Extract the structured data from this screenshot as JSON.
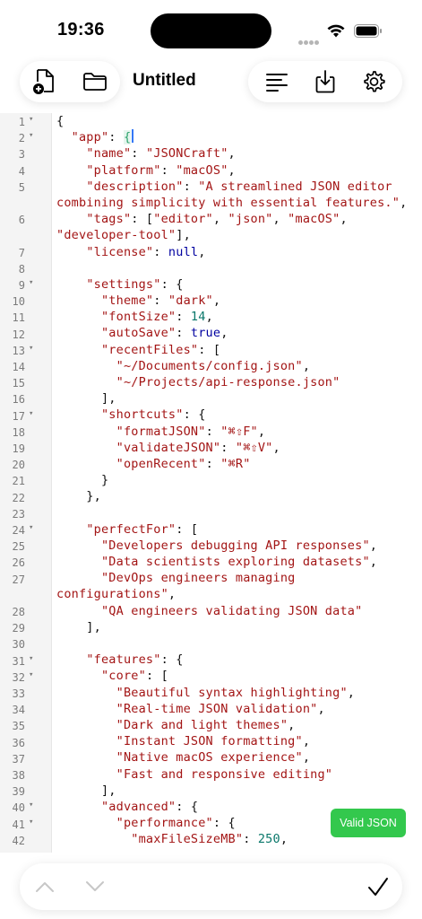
{
  "status_bar": {
    "time": "19:36"
  },
  "toolbar": {
    "title": "Untitled",
    "icons": {
      "new_file": "new-file-icon",
      "open_folder": "folder-icon",
      "format": "format-lines-icon",
      "save": "download-icon",
      "settings": "gear-icon"
    }
  },
  "editor": {
    "fold_marker": "▾",
    "lines": [
      {
        "n": "1",
        "fold": true
      },
      {
        "n": "2",
        "fold": true
      },
      {
        "n": "3",
        "fold": false
      },
      {
        "n": "4",
        "fold": false
      },
      {
        "n": "5",
        "fold": false
      },
      {
        "n": "",
        "fold": false
      },
      {
        "n": "6",
        "fold": false
      },
      {
        "n": "",
        "fold": false
      },
      {
        "n": "7",
        "fold": false
      },
      {
        "n": "8",
        "fold": false
      },
      {
        "n": "9",
        "fold": true
      },
      {
        "n": "10",
        "fold": false
      },
      {
        "n": "11",
        "fold": false
      },
      {
        "n": "12",
        "fold": false
      },
      {
        "n": "13",
        "fold": true
      },
      {
        "n": "14",
        "fold": false
      },
      {
        "n": "15",
        "fold": false
      },
      {
        "n": "16",
        "fold": false
      },
      {
        "n": "17",
        "fold": true
      },
      {
        "n": "18",
        "fold": false
      },
      {
        "n": "19",
        "fold": false
      },
      {
        "n": "20",
        "fold": false
      },
      {
        "n": "21",
        "fold": false
      },
      {
        "n": "22",
        "fold": false
      },
      {
        "n": "23",
        "fold": false
      },
      {
        "n": "24",
        "fold": true
      },
      {
        "n": "25",
        "fold": false
      },
      {
        "n": "26",
        "fold": false
      },
      {
        "n": "27",
        "fold": false
      },
      {
        "n": "",
        "fold": false
      },
      {
        "n": "28",
        "fold": false
      },
      {
        "n": "29",
        "fold": false
      },
      {
        "n": "30",
        "fold": false
      },
      {
        "n": "31",
        "fold": true
      },
      {
        "n": "32",
        "fold": true
      },
      {
        "n": "33",
        "fold": false
      },
      {
        "n": "34",
        "fold": false
      },
      {
        "n": "35",
        "fold": false
      },
      {
        "n": "36",
        "fold": false
      },
      {
        "n": "37",
        "fold": false
      },
      {
        "n": "38",
        "fold": false
      },
      {
        "n": "39",
        "fold": false
      },
      {
        "n": "40",
        "fold": true
      },
      {
        "n": "41",
        "fold": true
      },
      {
        "n": "42",
        "fold": false
      }
    ],
    "code": [
      [
        [
          "p",
          "{"
        ]
      ],
      [
        [
          "p",
          "  "
        ],
        [
          "k",
          "\"app\""
        ],
        [
          "p",
          ": "
        ],
        [
          "h",
          "{"
        ],
        [
          "c",
          ""
        ]
      ],
      [
        [
          "p",
          "    "
        ],
        [
          "k",
          "\"name\""
        ],
        [
          "p",
          ": "
        ],
        [
          "s",
          "\"JSONCraft\""
        ],
        [
          "p",
          ","
        ]
      ],
      [
        [
          "p",
          "    "
        ],
        [
          "k",
          "\"platform\""
        ],
        [
          "p",
          ": "
        ],
        [
          "s",
          "\"macOS\""
        ],
        [
          "p",
          ","
        ]
      ],
      [
        [
          "p",
          "    "
        ],
        [
          "k",
          "\"description\""
        ],
        [
          "p",
          ": "
        ],
        [
          "s",
          "\"A streamlined JSON editor"
        ]
      ],
      [
        [
          "s",
          "combining simplicity with essential features.\""
        ],
        [
          "p",
          ","
        ]
      ],
      [
        [
          "p",
          "    "
        ],
        [
          "k",
          "\"tags\""
        ],
        [
          "p",
          ": ["
        ],
        [
          "s",
          "\"editor\""
        ],
        [
          "p",
          ", "
        ],
        [
          "s",
          "\"json\""
        ],
        [
          "p",
          ", "
        ],
        [
          "s",
          "\"macOS\""
        ],
        [
          "p",
          ","
        ]
      ],
      [
        [
          "s",
          "\"developer-tool\""
        ],
        [
          "p",
          "],"
        ]
      ],
      [
        [
          "p",
          "    "
        ],
        [
          "k",
          "\"license\""
        ],
        [
          "p",
          ": "
        ],
        [
          "b",
          "null"
        ],
        [
          "p",
          ","
        ]
      ],
      [
        [
          "p",
          ""
        ]
      ],
      [
        [
          "p",
          "    "
        ],
        [
          "k",
          "\"settings\""
        ],
        [
          "p",
          ": {"
        ]
      ],
      [
        [
          "p",
          "      "
        ],
        [
          "k",
          "\"theme\""
        ],
        [
          "p",
          ": "
        ],
        [
          "s",
          "\"dark\""
        ],
        [
          "p",
          ","
        ]
      ],
      [
        [
          "p",
          "      "
        ],
        [
          "k",
          "\"fontSize\""
        ],
        [
          "p",
          ": "
        ],
        [
          "n",
          "14"
        ],
        [
          "p",
          ","
        ]
      ],
      [
        [
          "p",
          "      "
        ],
        [
          "k",
          "\"autoSave\""
        ],
        [
          "p",
          ": "
        ],
        [
          "b",
          "true"
        ],
        [
          "p",
          ","
        ]
      ],
      [
        [
          "p",
          "      "
        ],
        [
          "k",
          "\"recentFiles\""
        ],
        [
          "p",
          ": ["
        ]
      ],
      [
        [
          "p",
          "        "
        ],
        [
          "s",
          "\"~/Documents/config.json\""
        ],
        [
          "p",
          ","
        ]
      ],
      [
        [
          "p",
          "        "
        ],
        [
          "s",
          "\"~/Projects/api-response.json\""
        ]
      ],
      [
        [
          "p",
          "      ],"
        ]
      ],
      [
        [
          "p",
          "      "
        ],
        [
          "k",
          "\"shortcuts\""
        ],
        [
          "p",
          ": {"
        ]
      ],
      [
        [
          "p",
          "        "
        ],
        [
          "k",
          "\"formatJSON\""
        ],
        [
          "p",
          ": "
        ],
        [
          "s",
          "\"⌘⇧F\""
        ],
        [
          "p",
          ","
        ]
      ],
      [
        [
          "p",
          "        "
        ],
        [
          "k",
          "\"validateJSON\""
        ],
        [
          "p",
          ": "
        ],
        [
          "s",
          "\"⌘⇧V\""
        ],
        [
          "p",
          ","
        ]
      ],
      [
        [
          "p",
          "        "
        ],
        [
          "k",
          "\"openRecent\""
        ],
        [
          "p",
          ": "
        ],
        [
          "s",
          "\"⌘R\""
        ]
      ],
      [
        [
          "p",
          "      }"
        ]
      ],
      [
        [
          "p",
          "    },"
        ]
      ],
      [
        [
          "p",
          ""
        ]
      ],
      [
        [
          "p",
          "    "
        ],
        [
          "k",
          "\"perfectFor\""
        ],
        [
          "p",
          ": ["
        ]
      ],
      [
        [
          "p",
          "      "
        ],
        [
          "s",
          "\"Developers debugging API responses\""
        ],
        [
          "p",
          ","
        ]
      ],
      [
        [
          "p",
          "      "
        ],
        [
          "s",
          "\"Data scientists exploring datasets\""
        ],
        [
          "p",
          ","
        ]
      ],
      [
        [
          "p",
          "      "
        ],
        [
          "s",
          "\"DevOps engineers managing"
        ]
      ],
      [
        [
          "s",
          "configurations\""
        ],
        [
          "p",
          ","
        ]
      ],
      [
        [
          "p",
          "      "
        ],
        [
          "s",
          "\"QA engineers validating JSON data\""
        ]
      ],
      [
        [
          "p",
          "    ],"
        ]
      ],
      [
        [
          "p",
          ""
        ]
      ],
      [
        [
          "p",
          "    "
        ],
        [
          "k",
          "\"features\""
        ],
        [
          "p",
          ": {"
        ]
      ],
      [
        [
          "p",
          "      "
        ],
        [
          "k",
          "\"core\""
        ],
        [
          "p",
          ": ["
        ]
      ],
      [
        [
          "p",
          "        "
        ],
        [
          "s",
          "\"Beautiful syntax highlighting\""
        ],
        [
          "p",
          ","
        ]
      ],
      [
        [
          "p",
          "        "
        ],
        [
          "s",
          "\"Real-time JSON validation\""
        ],
        [
          "p",
          ","
        ]
      ],
      [
        [
          "p",
          "        "
        ],
        [
          "s",
          "\"Dark and light themes\""
        ],
        [
          "p",
          ","
        ]
      ],
      [
        [
          "p",
          "        "
        ],
        [
          "s",
          "\"Instant JSON formatting\""
        ],
        [
          "p",
          ","
        ]
      ],
      [
        [
          "p",
          "        "
        ],
        [
          "s",
          "\"Native macOS experience\""
        ],
        [
          "p",
          ","
        ]
      ],
      [
        [
          "p",
          "        "
        ],
        [
          "s",
          "\"Fast and responsive editing\""
        ]
      ],
      [
        [
          "p",
          "      ],"
        ]
      ],
      [
        [
          "p",
          "      "
        ],
        [
          "k",
          "\"advanced\""
        ],
        [
          "p",
          ": {"
        ]
      ],
      [
        [
          "p",
          "        "
        ],
        [
          "k",
          "\"performance\""
        ],
        [
          "p",
          ": {"
        ]
      ],
      [
        [
          "p",
          "          "
        ],
        [
          "k",
          "\"maxFileSizeMB\""
        ],
        [
          "p",
          ": "
        ],
        [
          "n",
          "250"
        ],
        [
          "p",
          ","
        ]
      ]
    ]
  },
  "validation": {
    "label": "Valid JSON",
    "color": "#33c84d"
  },
  "bottom_bar": {
    "icons": {
      "prev": "chevron-up-icon",
      "next": "chevron-down-icon",
      "done": "checkmark-icon"
    }
  },
  "colors": {
    "key": "#a31515",
    "string": "#a31515",
    "keyword": "#0000a0",
    "number": "#09776a",
    "cursor": "#3478f6"
  }
}
